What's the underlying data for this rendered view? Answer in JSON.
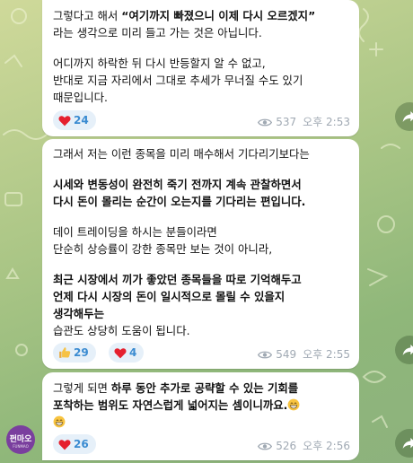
{
  "messages": [
    {
      "id": "m1",
      "paragraphs": [
        {
          "lines": [
            [
              {
                "t": "그렇다고 해서 "
              },
              {
                "t": "“여기까지 빠졌으니 이제 다시 오르겠지”",
                "b": true
              }
            ],
            [
              {
                "t": "라는 생각으로 미리 들고 가는 것은 아닙니다."
              }
            ]
          ]
        },
        {
          "lines": [
            [
              {
                "t": "어디까지 하락한 뒤 다시 반등할지 알 수 없고,"
              }
            ],
            [
              {
                "t": "반대로 지금 자리에서 그대로 추세가 무너질 수도 있기"
              }
            ],
            [
              {
                "t": "때문입니다."
              }
            ]
          ]
        }
      ],
      "reactions": [
        {
          "emoji": "heart",
          "count": "24"
        }
      ],
      "views": "537",
      "time": "오후 2:53"
    },
    {
      "id": "m2",
      "paragraphs": [
        {
          "lines": [
            [
              {
                "t": "그래서 저는 이런 종목을 미리 매수해서 기다리기보다는"
              }
            ]
          ]
        },
        {
          "lines": [
            [
              {
                "t": "시세와 변동성이 완전히 죽기 전까지 계속 관찰하면서",
                "b": true
              }
            ],
            [
              {
                "t": "다시 돈이 몰리는 순간이 오는지를 기다리는 편입니다.",
                "b": true
              }
            ]
          ]
        },
        {
          "lines": [
            [
              {
                "t": "데이 트레이딩을 하시는 분들이라면"
              }
            ],
            [
              {
                "t": "단순히 상승률이 강한 종목만 보는 것이 아니라,"
              }
            ]
          ]
        },
        {
          "lines": [
            [
              {
                "t": "최근 시장에서 끼가 좋았던 종목들을 따로 기억해두고",
                "b": true
              }
            ],
            [
              {
                "t": "언제 다시 시장의 돈이 일시적으로 몰릴 수 있을지",
                "b": true
              }
            ],
            [
              {
                "t": "생각해두는",
                "b": true
              }
            ],
            [
              {
                "t": "습관도 상당히 도움이 됩니다."
              }
            ]
          ]
        }
      ],
      "reactions": [
        {
          "emoji": "thumbs-up",
          "count": "29"
        },
        {
          "emoji": "heart",
          "count": "4"
        }
      ],
      "views": "549",
      "time": "오후 2:55"
    },
    {
      "id": "m3",
      "paragraphs": [
        {
          "lines": [
            [
              {
                "t": "그렇게 되면 "
              },
              {
                "t": "하루 동안 추가로 공략할 수 있는 기회를",
                "b": true
              }
            ],
            [
              {
                "t": "포착하는 범위도 자연스럽게 넓어지는 셈이니까요.",
                "b": true
              },
              {
                "emoji": "grin"
              }
            ],
            [
              {
                "emoji": "grin"
              }
            ]
          ]
        }
      ],
      "reactions": [
        {
          "emoji": "heart",
          "count": "26"
        }
      ],
      "views": "526",
      "time": "오후 2:56"
    }
  ],
  "avatar": {
    "logo": "펀마오",
    "tagline": "FUNMAO"
  },
  "colors": {
    "reaction_text": "#3a8bd1",
    "reaction_bg": "#e6f0f9",
    "meta_text": "#a0a9b3",
    "heart": "#e5202e"
  },
  "icons": {
    "views": "eye-icon",
    "share": "share-arrow-icon",
    "heart": "heart-icon",
    "thumbs_up": "thumbs-up-icon",
    "grin": "grinning-face-icon"
  }
}
